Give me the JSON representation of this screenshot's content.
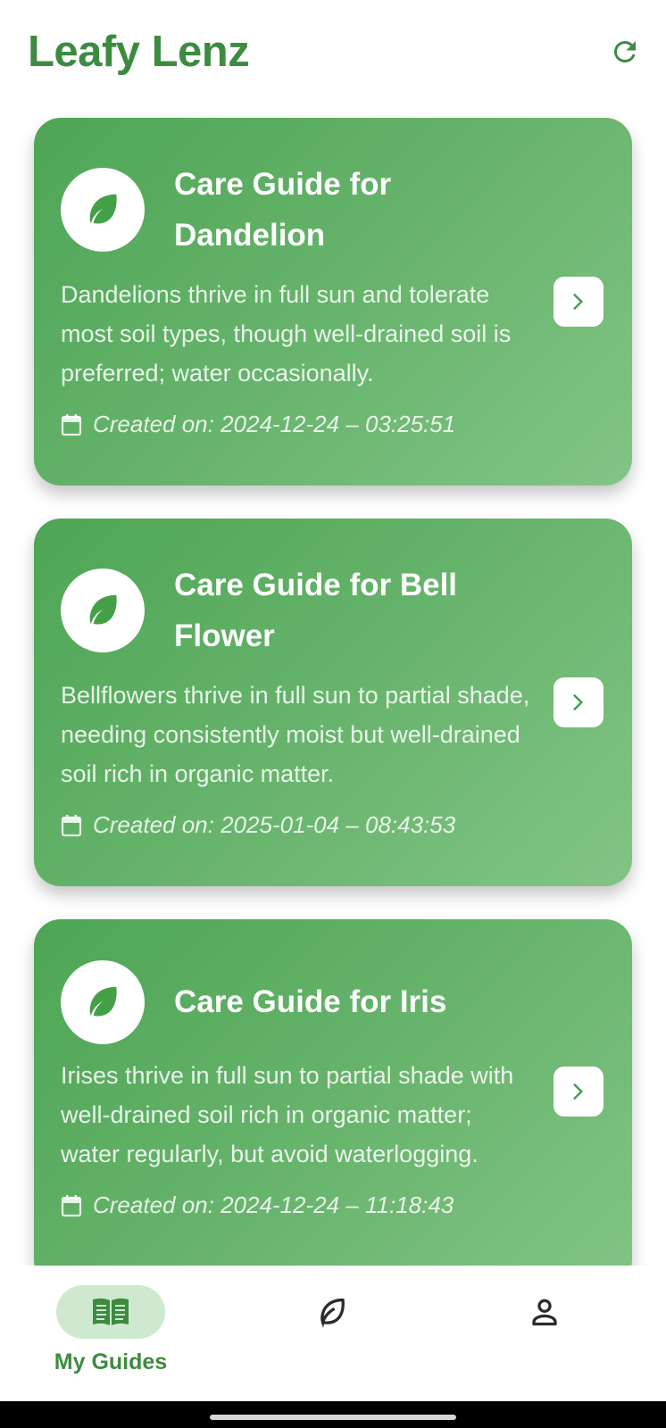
{
  "app": {
    "title": "Leafy Lenz",
    "accent_color": "#3d8b40",
    "refresh_icon": "refresh-icon"
  },
  "guides": [
    {
      "title": "Care Guide for Dandelion",
      "description": "Dandelions thrive in full sun and tolerate most soil types, though well-drained soil is preferred; water occasionally.",
      "created": "Created on: 2024-12-24 – 03:25:51"
    },
    {
      "title": "Care Guide for Bell Flower",
      "description": "Bellflowers thrive in full sun to partial shade, needing consistently moist but well-drained soil rich in organic matter.",
      "created": "Created on: 2025-01-04 – 08:43:53"
    },
    {
      "title": "Care Guide for Iris",
      "description": "Irises thrive in full sun to partial shade with well-drained soil rich in organic matter; water regularly, but avoid waterlogging.",
      "created": "Created on: 2024-12-24 – 11:18:43"
    }
  ],
  "bottom_nav": {
    "items": [
      {
        "label": "My Guides",
        "icon": "book-icon",
        "active": true
      },
      {
        "label": "",
        "icon": "leaf-icon",
        "active": false
      },
      {
        "label": "",
        "icon": "person-icon",
        "active": false
      }
    ]
  }
}
